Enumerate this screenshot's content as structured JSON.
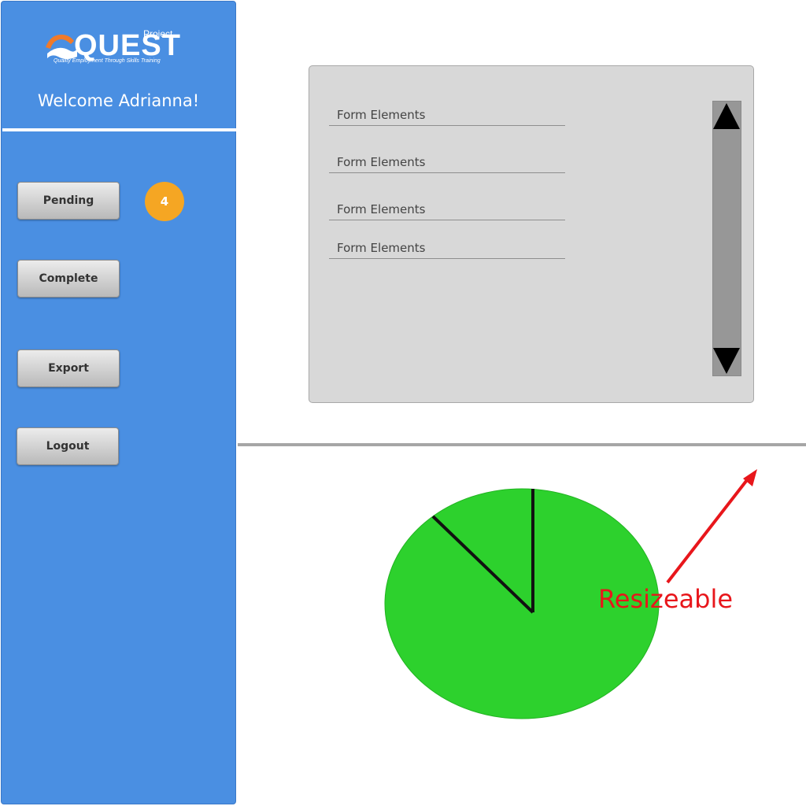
{
  "sidebar": {
    "logo": {
      "project": "Project",
      "name": "QUEST",
      "tagline": "Quality Employment Through Skills Training"
    },
    "welcome": "Welcome Adrianna!",
    "buttons": {
      "pending": "Pending",
      "complete": "Complete",
      "export": "Export",
      "logout": "Logout"
    },
    "pending_count": "4"
  },
  "form": {
    "fields": [
      "Form Elements",
      "Form Elements",
      "Form Elements",
      "Form Elements"
    ]
  },
  "annotation": {
    "label": "Resizeable",
    "color": "#e8161b"
  },
  "colors": {
    "sidebar": "#4a8fe2",
    "badge": "#f5a623",
    "pie_fill": "#2dd12d"
  }
}
